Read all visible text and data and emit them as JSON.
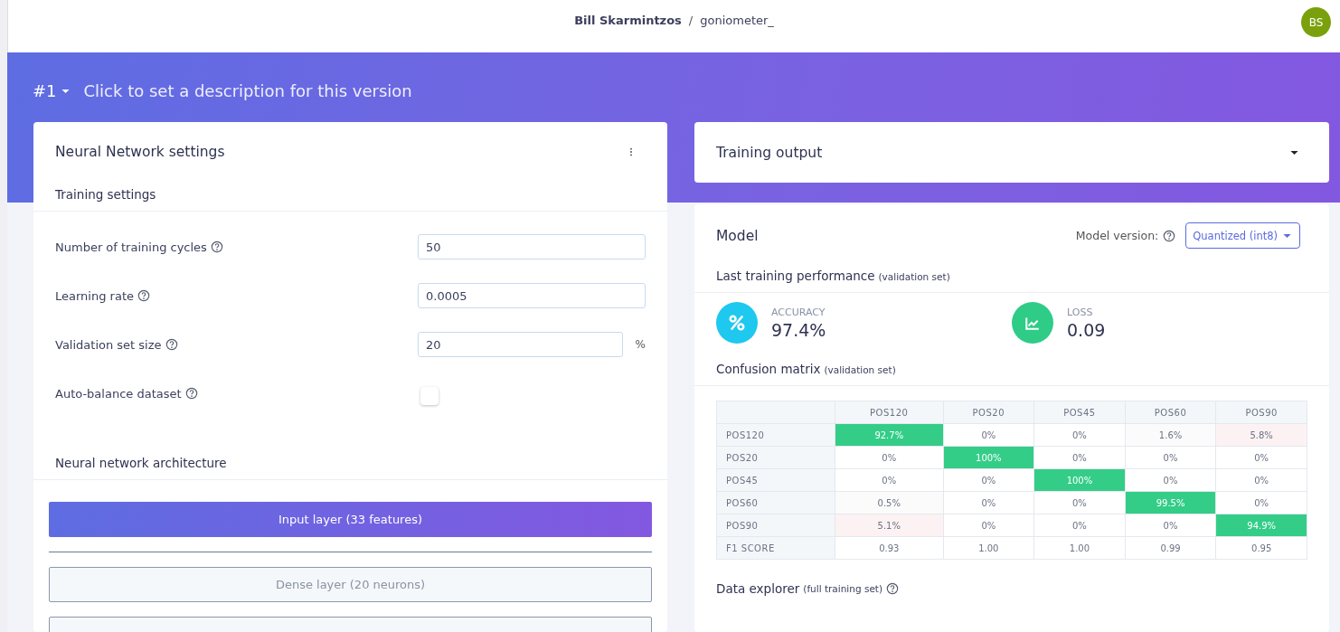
{
  "header": {
    "user": "Bill Skarmintzos",
    "separator": "/",
    "project": "goniometer_",
    "avatar": "BS"
  },
  "version": {
    "number": "#1",
    "description": "Click to set a description for this version"
  },
  "settings": {
    "title": "Neural Network settings",
    "section": "Training settings",
    "fields": [
      {
        "kind": "input",
        "label": "Number of training cycles",
        "value": "50"
      },
      {
        "kind": "input",
        "label": "Learning rate",
        "value": "0.0005"
      },
      {
        "kind": "input",
        "label": "Validation set size",
        "value": "20",
        "unit": "%"
      },
      {
        "kind": "checkbox",
        "label": "Auto-balance dataset",
        "checked": false
      }
    ],
    "architecture": {
      "title": "Neural network architecture",
      "layers": [
        {
          "kind": "input",
          "label": "Input layer (33 features)"
        },
        {
          "kind": "dense",
          "label": "Dense layer (20 neurons)"
        }
      ]
    }
  },
  "training_output": {
    "title": "Training output",
    "expanded": false
  },
  "model": {
    "title": "Model",
    "version_label": "Model version:",
    "version_value": "Quantized (int8)",
    "performance": {
      "title": "Last training performance",
      "note": "(validation set)"
    },
    "metrics": [
      {
        "kind": "accuracy",
        "label": "ACCURACY",
        "value": "97.4%"
      },
      {
        "kind": "loss",
        "label": "LOSS",
        "value": "0.09"
      }
    ],
    "confusion": {
      "title": "Confusion matrix",
      "note": "(validation set)",
      "columns": [
        "POS120",
        "POS20",
        "POS45",
        "POS60",
        "POS90"
      ],
      "rows": [
        {
          "label": "POS120",
          "cells": [
            {
              "text": "92.7%",
              "kind": "good"
            },
            {
              "text": "0%",
              "kind": "plain"
            },
            {
              "text": "0%",
              "kind": "plain"
            },
            {
              "text": "1.6%",
              "kind": "faint"
            },
            {
              "text": "5.8%",
              "kind": "bad"
            }
          ]
        },
        {
          "label": "POS20",
          "cells": [
            {
              "text": "0%",
              "kind": "plain"
            },
            {
              "text": "100%",
              "kind": "good"
            },
            {
              "text": "0%",
              "kind": "plain"
            },
            {
              "text": "0%",
              "kind": "plain"
            },
            {
              "text": "0%",
              "kind": "plain"
            }
          ]
        },
        {
          "label": "POS45",
          "cells": [
            {
              "text": "0%",
              "kind": "plain"
            },
            {
              "text": "0%",
              "kind": "plain"
            },
            {
              "text": "100%",
              "kind": "good"
            },
            {
              "text": "0%",
              "kind": "plain"
            },
            {
              "text": "0%",
              "kind": "plain"
            }
          ]
        },
        {
          "label": "POS60",
          "cells": [
            {
              "text": "0.5%",
              "kind": "faint"
            },
            {
              "text": "0%",
              "kind": "plain"
            },
            {
              "text": "0%",
              "kind": "plain"
            },
            {
              "text": "99.5%",
              "kind": "good"
            },
            {
              "text": "0%",
              "kind": "plain"
            }
          ]
        },
        {
          "label": "POS90",
          "cells": [
            {
              "text": "5.1%",
              "kind": "bad"
            },
            {
              "text": "0%",
              "kind": "plain"
            },
            {
              "text": "0%",
              "kind": "plain"
            },
            {
              "text": "0%",
              "kind": "plain"
            },
            {
              "text": "94.9%",
              "kind": "good"
            }
          ]
        },
        {
          "label": "F1 SCORE",
          "cells": [
            {
              "text": "0.93",
              "kind": "plain"
            },
            {
              "text": "1.00",
              "kind": "plain"
            },
            {
              "text": "1.00",
              "kind": "plain"
            },
            {
              "text": "0.99",
              "kind": "plain"
            },
            {
              "text": "0.95",
              "kind": "plain"
            }
          ]
        }
      ]
    },
    "explorer": {
      "title": "Data explorer",
      "note": "(full training set)"
    }
  }
}
